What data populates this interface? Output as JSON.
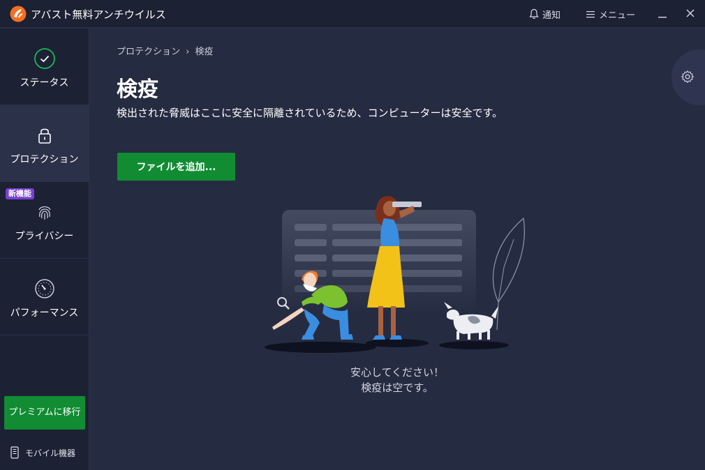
{
  "titlebar": {
    "app_title": "アバスト無料アンチウイルス",
    "notify_label": "通知",
    "menu_label": "メニュー"
  },
  "sidebar": {
    "items": [
      {
        "label": "ステータス",
        "icon": "check-circle-icon"
      },
      {
        "label": "プロテクション",
        "icon": "lock-icon"
      },
      {
        "label": "プライバシー",
        "icon": "fingerprint-icon",
        "badge": "新機能"
      },
      {
        "label": "パフォーマンス",
        "icon": "speedometer-icon"
      }
    ],
    "premium_label": "プレミアムに移行",
    "mobile_label": "モバイル機器"
  },
  "main": {
    "breadcrumb": {
      "parent": "プロテクション",
      "separator": "›",
      "current": "検疫"
    },
    "title": "検疫",
    "description": "検出された脅威はここに安全に隔離されているため、コンピューターは安全です。",
    "add_button": "ファイルを追加...",
    "empty_line1": "安心してください！",
    "empty_line2": "検疫は空です。"
  },
  "colors": {
    "background": "#252b41",
    "sidebar": "#1c2133",
    "accent_green": "#118c32",
    "badge_purple": "#7a3fd1",
    "brand_orange": "#f36f23"
  }
}
